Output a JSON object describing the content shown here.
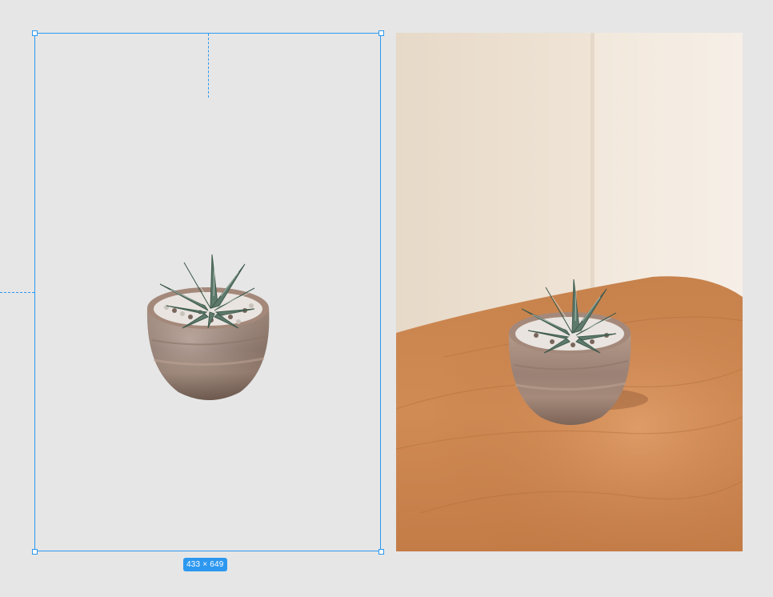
{
  "canvas": {
    "background": "#e6e6e6",
    "selection_color": "#2d98ef"
  },
  "frame_left": {
    "dimensions_label": "433 × 649",
    "content": "cutout-succulent-pot"
  },
  "photo_right": {
    "content": "succulent-pot-on-wooden-table"
  }
}
